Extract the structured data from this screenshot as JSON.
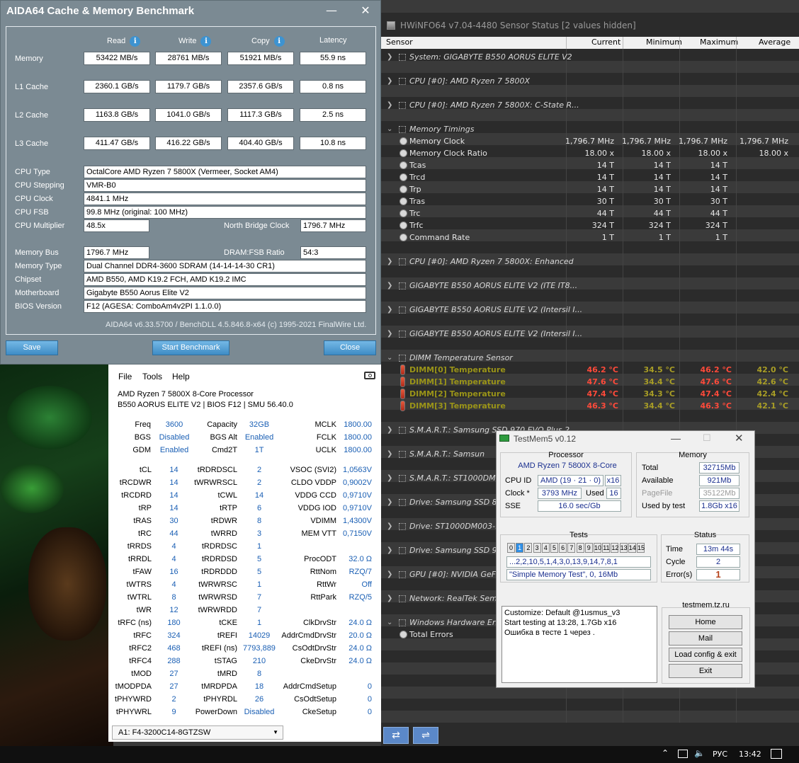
{
  "aida": {
    "title": "AIDA64 Cache & Memory Benchmark",
    "col_headers": [
      "Read",
      "Write",
      "Copy",
      "Latency"
    ],
    "bench_rows": [
      {
        "label": "Memory",
        "read": "53422 MB/s",
        "write": "28761 MB/s",
        "copy": "51921 MB/s",
        "latency": "55.9 ns"
      },
      {
        "label": "L1 Cache",
        "read": "2360.1 GB/s",
        "write": "1179.7 GB/s",
        "copy": "2357.6 GB/s",
        "latency": "0.8 ns"
      },
      {
        "label": "L2 Cache",
        "read": "1163.8 GB/s",
        "write": "1041.0 GB/s",
        "copy": "1117.3 GB/s",
        "latency": "2.5 ns"
      },
      {
        "label": "L3 Cache",
        "read": "411.47 GB/s",
        "write": "416.22 GB/s",
        "copy": "404.40 GB/s",
        "latency": "10.8 ns"
      }
    ],
    "cpu_type_label": "CPU Type",
    "cpu_type": "OctalCore AMD Ryzen 7 5800X  (Vermeer, Socket AM4)",
    "cpu_stepping_label": "CPU Stepping",
    "cpu_stepping": "VMR-B0",
    "cpu_clock_label": "CPU Clock",
    "cpu_clock": "4841.1 MHz",
    "cpu_fsb_label": "CPU FSB",
    "cpu_fsb": "99.8 MHz  (original: 100 MHz)",
    "cpu_mult_label": "CPU Multiplier",
    "cpu_mult": "48.5x",
    "nb_clock_label": "North Bridge Clock",
    "nb_clock": "1796.7 MHz",
    "mem_bus_label": "Memory Bus",
    "mem_bus": "1796.7 MHz",
    "dram_fsb_label": "DRAM:FSB Ratio",
    "dram_fsb": "54:3",
    "mem_type_label": "Memory Type",
    "mem_type": "Dual Channel DDR4-3600 SDRAM  (14-14-14-30 CR1)",
    "chipset_label": "Chipset",
    "chipset": "AMD B550, AMD K19.2 FCH, AMD K19.2 IMC",
    "mobo_label": "Motherboard",
    "mobo": "Gigabyte B550 Aorus Elite V2",
    "bios_label": "BIOS Version",
    "bios": "F12  (AGESA: ComboAm4v2PI 1.1.0.0)",
    "footer": "AIDA64 v6.33.5700 / BenchDLL 4.5.846.8-x64  (c) 1995-2021 FinalWire Ltd.",
    "save": "Save",
    "start": "Start Benchmark",
    "close": "Close"
  },
  "hw": {
    "title": "HWiNFO64 v7.04-4480 Sensor Status [2 values hidden]",
    "headers": [
      "Sensor",
      "Current",
      "Minimum",
      "Maximum",
      "Average"
    ],
    "groups": {
      "g1": "System: GIGABYTE B550 AORUS ELITE V2",
      "g2": "CPU [#0]: AMD Ryzen 7 5800X",
      "g3": "CPU [#0]: AMD Ryzen 7 5800X: C-State R...",
      "g4": "Memory Timings",
      "g5": "CPU [#0]: AMD Ryzen 7 5800X: Enhanced",
      "g6": "GIGABYTE B550 AORUS ELITE V2 (ITE IT8...",
      "g7": "GIGABYTE B550 AORUS ELITE V2 (Intersil I...",
      "g8": "GIGABYTE B550 AORUS ELITE V2 (Intersil I...",
      "g9": "DIMM Temperature Sensor",
      "g10": "S.M.A.R.T.: Samsung SSD 970 EVO Plus 2...",
      "g11": "S.M.A.R.T.: Samsun",
      "g12": "S.M.A.R.T.: ST1000DM00",
      "g13": "Drive: Samsung SSD 860",
      "g14": "Drive: ST1000DM003-1ER",
      "g15": "Drive: Samsung SSD 970",
      "g16": "GPU [#0]: NVIDIA GeFor",
      "g17": "Network: RealTek Semico",
      "g18": "Windows Hardware Error",
      "total_errors": "Total Errors"
    },
    "timings": [
      {
        "name": "Memory Clock",
        "cur": "1,796.7 MHz",
        "min": "1,796.7 MHz",
        "max": "1,796.7 MHz",
        "avg": "1,796.7 MHz"
      },
      {
        "name": "Memory Clock Ratio",
        "cur": "18.00 x",
        "min": "18.00 x",
        "max": "18.00 x",
        "avg": "18.00 x"
      },
      {
        "name": "Tcas",
        "cur": "14 T",
        "min": "14 T",
        "max": "14 T",
        "avg": ""
      },
      {
        "name": "Trcd",
        "cur": "14 T",
        "min": "14 T",
        "max": "14 T",
        "avg": ""
      },
      {
        "name": "Trp",
        "cur": "14 T",
        "min": "14 T",
        "max": "14 T",
        "avg": ""
      },
      {
        "name": "Tras",
        "cur": "30 T",
        "min": "30 T",
        "max": "30 T",
        "avg": ""
      },
      {
        "name": "Trc",
        "cur": "44 T",
        "min": "44 T",
        "max": "44 T",
        "avg": ""
      },
      {
        "name": "Trfc",
        "cur": "324 T",
        "min": "324 T",
        "max": "324 T",
        "avg": ""
      },
      {
        "name": "Command Rate",
        "cur": "1 T",
        "min": "1 T",
        "max": "1 T",
        "avg": ""
      }
    ],
    "dimm": [
      {
        "name": "DIMM[0] Temperature",
        "cur": "46.2 °C",
        "min": "34.5 °C",
        "max": "46.2 °C",
        "avg": "42.0 °C"
      },
      {
        "name": "DIMM[1] Temperature",
        "cur": "47.6 °C",
        "min": "34.4 °C",
        "max": "47.6 °C",
        "avg": "42.6 °C"
      },
      {
        "name": "DIMM[2] Temperature",
        "cur": "47.4 °C",
        "min": "34.3 °C",
        "max": "47.4 °C",
        "avg": "42.4 °C"
      },
      {
        "name": "DIMM[3] Temperature",
        "cur": "46.3 °C",
        "min": "34.4 °C",
        "max": "46.3 °C",
        "avg": "42.1 °C"
      }
    ]
  },
  "zen": {
    "menu": [
      "File",
      "Tools",
      "Help"
    ],
    "cpu": "AMD Ryzen 7 5800X 8-Core Processor",
    "board": "B550 AORUS ELITE V2 | BIOS F12 | SMU 56.40.0",
    "top": [
      [
        "Freq",
        "3600",
        "Capacity",
        "32GB",
        "MCLK",
        "1800.00"
      ],
      [
        "BGS",
        "Disabled",
        "BGS Alt",
        "Enabled",
        "FCLK",
        "1800.00"
      ],
      [
        "GDM",
        "Enabled",
        "Cmd2T",
        "1T",
        "UCLK",
        "1800.00"
      ]
    ],
    "rows": [
      [
        "tCL",
        "14",
        "tRDRDSCL",
        "2",
        "VSOC (SVI2)",
        "1,0563V"
      ],
      [
        "tRCDWR",
        "14",
        "tWRWRSCL",
        "2",
        "CLDO VDDP",
        "0,9002V"
      ],
      [
        "tRCDRD",
        "14",
        "tCWL",
        "14",
        "VDDG CCD",
        "0,9710V"
      ],
      [
        "tRP",
        "14",
        "tRTP",
        "6",
        "VDDG IOD",
        "0,9710V"
      ],
      [
        "tRAS",
        "30",
        "tRDWR",
        "8",
        "VDIMM",
        "1,4300V"
      ],
      [
        "tRC",
        "44",
        "tWRRD",
        "3",
        "MEM VTT",
        "0,7150V"
      ],
      [
        "tRRDS",
        "4",
        "tRDRDSC",
        "1",
        "",
        ""
      ],
      [
        "tRRDL",
        "4",
        "tRDRDSD",
        "5",
        "ProcODT",
        "32.0 Ω"
      ],
      [
        "tFAW",
        "16",
        "tRDRDDD",
        "5",
        "RttNom",
        "RZQ/7"
      ],
      [
        "tWTRS",
        "4",
        "tWRWRSC",
        "1",
        "RttWr",
        "Off"
      ],
      [
        "tWTRL",
        "8",
        "tWRWRSD",
        "7",
        "RttPark",
        "RZQ/5"
      ],
      [
        "tWR",
        "12",
        "tWRWRDD",
        "7",
        "",
        ""
      ],
      [
        "tRFC (ns)",
        "180",
        "tCKE",
        "1",
        "ClkDrvStr",
        "24.0 Ω"
      ],
      [
        "tRFC",
        "324",
        "tREFI",
        "14029",
        "AddrCmdDrvStr",
        "20.0 Ω"
      ],
      [
        "tRFC2",
        "468",
        "tREFI (ns)",
        "7793,889",
        "CsOdtDrvStr",
        "24.0 Ω"
      ],
      [
        "tRFC4",
        "288",
        "tSTAG",
        "210",
        "CkeDrvStr",
        "24.0 Ω"
      ],
      [
        "tMOD",
        "27",
        "tMRD",
        "8",
        "",
        ""
      ],
      [
        "tMODPDA",
        "27",
        "tMRDPDA",
        "18",
        "AddrCmdSetup",
        "0"
      ],
      [
        "tPHYWRD",
        "2",
        "tPHYRDL",
        "26",
        "CsOdtSetup",
        "0"
      ],
      [
        "tPHYWRL",
        "9",
        "PowerDown",
        "Disabled",
        "CkeSetup",
        "0"
      ]
    ],
    "dimm_select": "A1: F4-3200C14-8GTZSW"
  },
  "tm": {
    "title": "TestMem5 v0.12",
    "processor": "Processor",
    "cpu_name": "AMD Ryzen 7 5800X 8-Core",
    "cpuid_label": "CPU ID",
    "cpuid": "AMD  (19 · 21 · 0)",
    "cpuid_x": "x16",
    "clock_label": "Clock *",
    "clock": "3793 MHz",
    "used_label": "Used",
    "used": "16",
    "sse_label": "SSE",
    "sse": "16.0 sec/Gb",
    "memory": "Memory",
    "total_label": "Total",
    "total": "32715Mb",
    "avail_label": "Available",
    "avail": "921Mb",
    "pagefile_label": "PageFile",
    "pagefile": "35122Mb",
    "usedby_label": "Used by test",
    "usedby": "1.8Gb x16",
    "tests": "Tests",
    "status": "Status",
    "test_nums": [
      "0",
      "1",
      "2",
      "3",
      "4",
      "5",
      "6",
      "7",
      "8",
      "9",
      "10",
      "11",
      "12",
      "13",
      "14",
      "15"
    ],
    "active_test": 1,
    "sequence": "...2,2,10,5,1,4,3,0,13,9,14,7,8,1",
    "current_test": "\"Simple Memory Test\", 0, 16Mb",
    "time_label": "Time",
    "time": "13m 44s",
    "cycle_label": "Cycle",
    "cycle": "2",
    "errors_label": "Error(s)",
    "errors": "1",
    "log": [
      "Customize: Default @1usmus_v3",
      "Start testing at 13:28, 1.7Gb x16",
      "Ошибка в тесте 1 через ."
    ],
    "site": "testmem.tz.ru",
    "btn_home": "Home",
    "btn_mail": "Mail",
    "btn_load": "Load config & exit",
    "btn_exit": "Exit"
  },
  "taskbar": {
    "lang": "РУС",
    "time": "13:42"
  }
}
